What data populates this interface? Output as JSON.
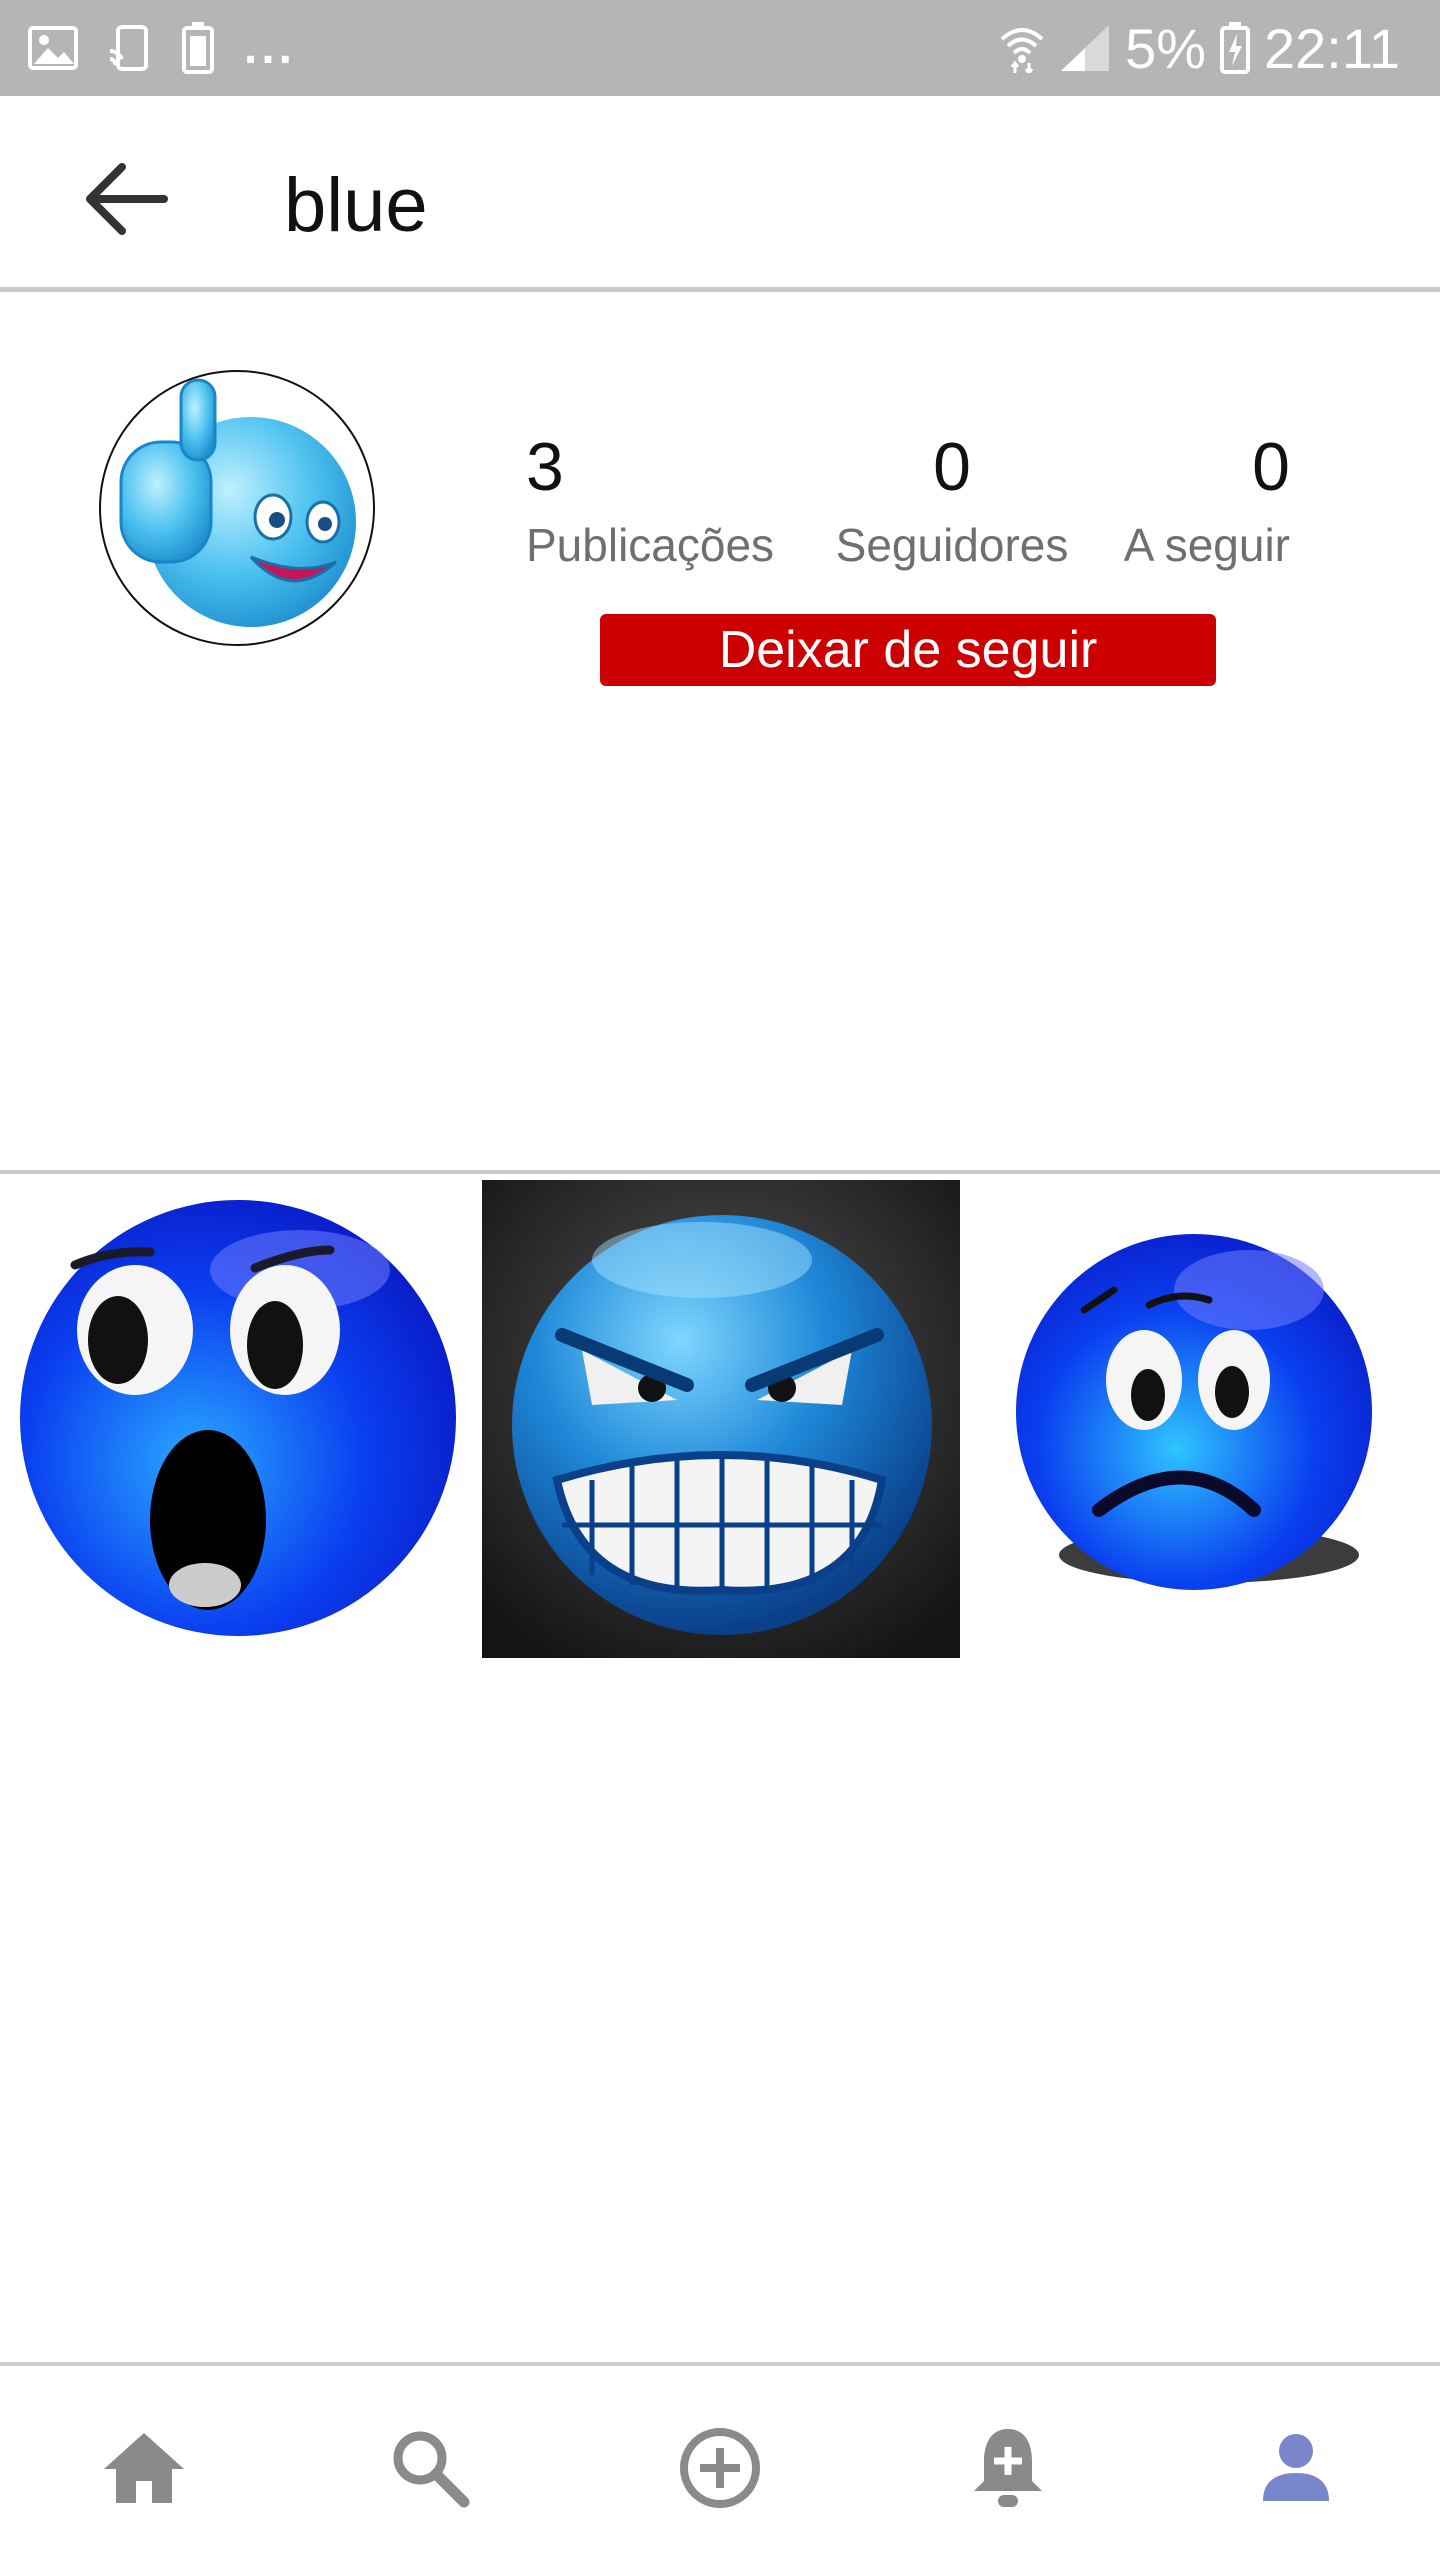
{
  "status_bar": {
    "icons_left": [
      "image-icon",
      "screen-cast-icon",
      "battery-saver-icon"
    ],
    "overflow": "...",
    "icons_right": [
      "wifi-icon",
      "signal-icon",
      "battery-charging-icon"
    ],
    "battery_percent": "5%",
    "time": "22:11"
  },
  "app_bar": {
    "back_icon": "arrow-back-icon",
    "title": "blue"
  },
  "profile": {
    "avatar_icon": "blue-thumbs-up-smiley",
    "stats": [
      {
        "value": "3",
        "label": "Publicações"
      },
      {
        "value": "0",
        "label": "Seguidores"
      },
      {
        "value": "0",
        "label": "A seguir"
      }
    ],
    "action_label": "Deixar de seguir",
    "action_color": "#cc0000"
  },
  "posts": [
    {
      "icon": "shocked-blue-smiley"
    },
    {
      "icon": "angry-blue-smiley"
    },
    {
      "icon": "worried-blue-smiley"
    }
  ],
  "bottom_nav": {
    "items": [
      "home-icon",
      "search-icon",
      "add-circle-icon",
      "notification-add-icon",
      "profile-icon"
    ],
    "active_item": "profile-icon",
    "active_color": "#7986cb",
    "inactive_color": "#8a8a8a"
  }
}
